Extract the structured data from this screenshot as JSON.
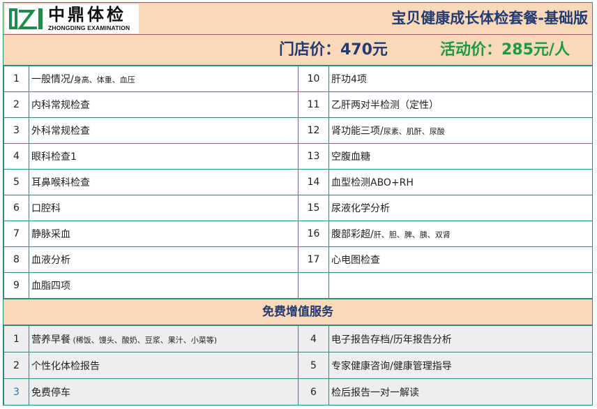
{
  "brand": {
    "name_cn": "中鼎体检",
    "name_en": "ZHONGDING EXAMINATION"
  },
  "title": "宝贝健康成长体检套餐-基础版",
  "prices": {
    "store": "门店价：470元",
    "promo": "活动价：285元/人"
  },
  "items": [
    {
      "left_no": "1",
      "left_main": "一般情况/",
      "left_sub": "身高、体重、血压",
      "right_no": "10",
      "right_main": "肝功4项",
      "right_sub": ""
    },
    {
      "left_no": "2",
      "left_main": "内科常规检查",
      "left_sub": "",
      "right_no": "11",
      "right_main": "乙肝两对半检测（定性）",
      "right_sub": ""
    },
    {
      "left_no": "3",
      "left_main": "外科常规检查",
      "left_sub": "",
      "right_no": "12",
      "right_main": "肾功能三项/",
      "right_sub": "尿素、肌酐、尿酸"
    },
    {
      "left_no": "4",
      "left_main": "眼科检查1",
      "left_sub": "",
      "right_no": "13",
      "right_main": "空腹血糖",
      "right_sub": ""
    },
    {
      "left_no": "5",
      "left_main": "耳鼻喉科检查",
      "left_sub": "",
      "right_no": "14",
      "right_main": "血型检测ABO+RH",
      "right_sub": ""
    },
    {
      "left_no": "6",
      "left_main": "口腔科",
      "left_sub": "",
      "right_no": "15",
      "right_main": "尿液化学分析",
      "right_sub": ""
    },
    {
      "left_no": "7",
      "left_main": "静脉采血",
      "left_sub": "",
      "right_no": "16",
      "right_main": "腹部彩超/",
      "right_sub": "肝、胆、脾、胰、双肾"
    },
    {
      "left_no": "8",
      "left_main": "血液分析",
      "left_sub": "",
      "right_no": "17",
      "right_main": "心电图检查",
      "right_sub": ""
    },
    {
      "left_no": "9",
      "left_main": "血脂四项",
      "left_sub": "",
      "right_no": "",
      "right_main": "",
      "right_sub": ""
    }
  ],
  "free_services": {
    "heading": "免费增值服务",
    "rows": [
      {
        "left_no": "1",
        "left_main": "营养早餐",
        "left_sub": " (稀饭、馒头、酸奶、豆浆、果汁、小菜等)",
        "right_no": "4",
        "right_main": "电子报告存档/历年报告分析"
      },
      {
        "left_no": "2",
        "left_main": "个性化体检报告",
        "left_sub": "",
        "right_no": "5",
        "right_main": "专家健康咨询/健康管理指导"
      },
      {
        "left_no": "3",
        "left_main": "免费停车",
        "left_sub": "",
        "right_no": "6",
        "right_main": "检后报告一对一解读"
      }
    ]
  },
  "colors": {
    "header_bg": "#fad9b9",
    "title_blue": "#233a72",
    "promo_green": "#1b9a45",
    "border": "#2e8b7d"
  },
  "icons": {
    "logo": "zhongding-logo-icon"
  }
}
